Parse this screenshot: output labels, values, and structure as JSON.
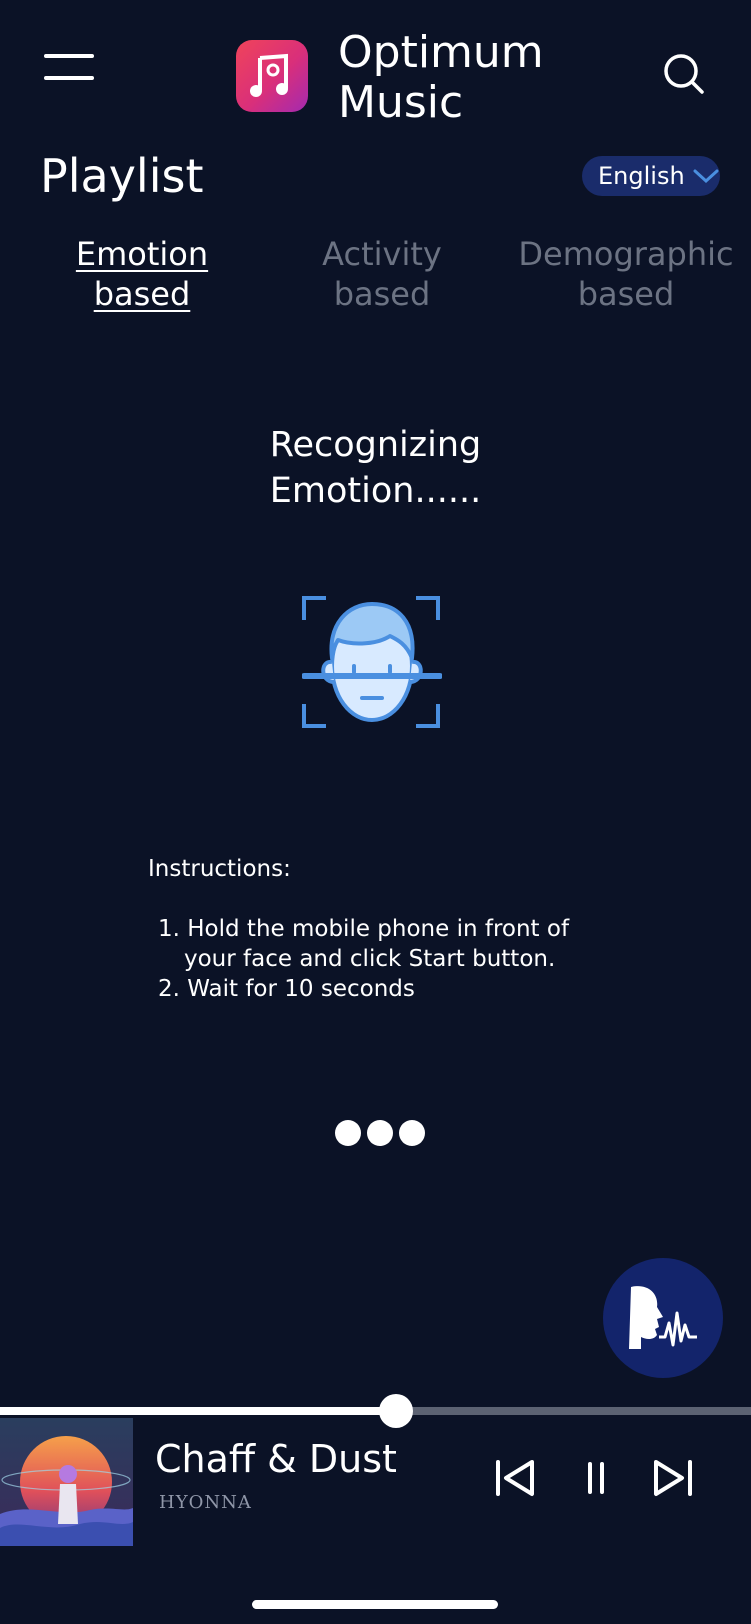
{
  "header": {
    "app_title": "Optimum Music",
    "menu_icon": "hamburger-menu-icon",
    "logo_icon": "music-note-logo-icon",
    "search_icon": "search-icon"
  },
  "page": {
    "title": "Playlist",
    "language": "English"
  },
  "tabs": [
    {
      "label": "Emotion based",
      "active": true
    },
    {
      "label": "Activity based",
      "active": false
    },
    {
      "label": "Demographic based",
      "active": false
    }
  ],
  "recognition": {
    "title_line1": "Recognizing",
    "title_line2": "Emotion......",
    "icon": "face-scan-icon"
  },
  "instructions": {
    "label": "Instructions:",
    "items": [
      "1.  Hold the mobile phone in front of",
      "your face and click Start button.",
      "2. Wait for 10 seconds"
    ]
  },
  "voice_button_icon": "voice-assistant-icon",
  "player": {
    "track_title": "Chaff & Dust",
    "artist": "HYONNA",
    "progress": 0.527,
    "prev_icon": "skip-previous-icon",
    "pause_icon": "pause-icon",
    "next_icon": "skip-next-icon"
  },
  "colors": {
    "background": "#0b1226",
    "accent": "#1a2c6b",
    "icon_blue": "#4a8fe0",
    "muted_text": "#6c7383"
  }
}
